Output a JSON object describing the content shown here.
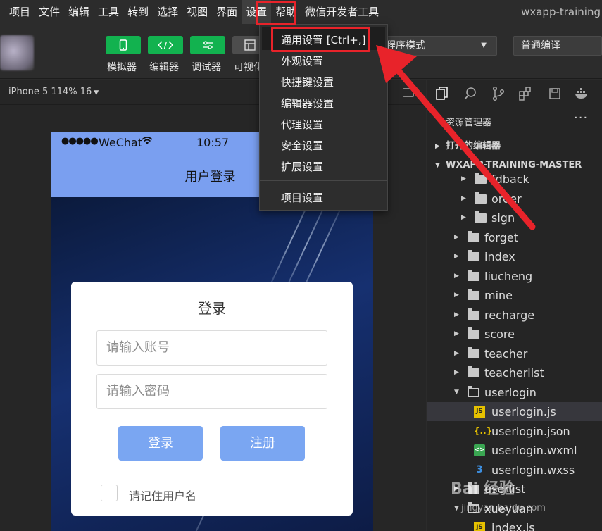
{
  "menubar": {
    "items": [
      "项目",
      "文件",
      "编辑",
      "工具",
      "转到",
      "选择",
      "视图",
      "界面",
      "设置",
      "帮助",
      "微信开发者工具"
    ],
    "window_title": "wxapp-training"
  },
  "toolbar": {
    "buttons": [
      {
        "label": "模拟器",
        "icon": "phone-icon"
      },
      {
        "label": "编辑器",
        "icon": "code-icon"
      },
      {
        "label": "调试器",
        "icon": "sliders-icon"
      },
      {
        "label": "可视化",
        "icon": "layout-icon"
      }
    ],
    "mode_select": "程序模式",
    "compile_select": "普通编译"
  },
  "simulator": {
    "device": "iPhone 5 114% 16",
    "statusbar": {
      "signal": "●●●●●",
      "carrier": "WeChat",
      "time": "10:57"
    },
    "nav_title": "用户登录",
    "login": {
      "title": "登录",
      "account_placeholder": "请输入账号",
      "password_placeholder": "请输入密码",
      "login_button": "登录",
      "register_button": "注册",
      "remember_label": "请记住用户名"
    }
  },
  "dropdown": {
    "items": [
      "通用设置  [Ctrl+,]",
      "外观设置",
      "快捷键设置",
      "编辑器设置",
      "代理设置",
      "安全设置",
      "扩展设置"
    ],
    "after_separator": "项目设置"
  },
  "explorer": {
    "title": "资源管理器",
    "more": "···",
    "open_editors": "打开的编辑器",
    "project": "WXAPP-TRAINING-MASTER",
    "sub_folders": [
      "fdback",
      "order",
      "sign"
    ],
    "folders": [
      "forget",
      "index",
      "liucheng",
      "mine",
      "recharge",
      "score",
      "teacher",
      "teacherlist",
      "userlogin"
    ],
    "files": [
      {
        "name": "userlogin.js",
        "icon": "JS"
      },
      {
        "name": "userlogin.json",
        "icon": "{..}"
      },
      {
        "name": "userlogin.wxml",
        "icon": "<>"
      },
      {
        "name": "userlogin.wxss",
        "icon": "3"
      }
    ],
    "tail_folders": [
      "userlist",
      "xueyuan"
    ],
    "tail_file": "index.js"
  },
  "watermark": {
    "line1": "Bai 经验",
    "line2": "jingyan.baidu.com"
  },
  "colors": {
    "accent_green": "#12b24f",
    "highlight_red": "#e8232a",
    "nav_blue": "#7a9ff0",
    "button_blue": "#7aa6f2"
  }
}
